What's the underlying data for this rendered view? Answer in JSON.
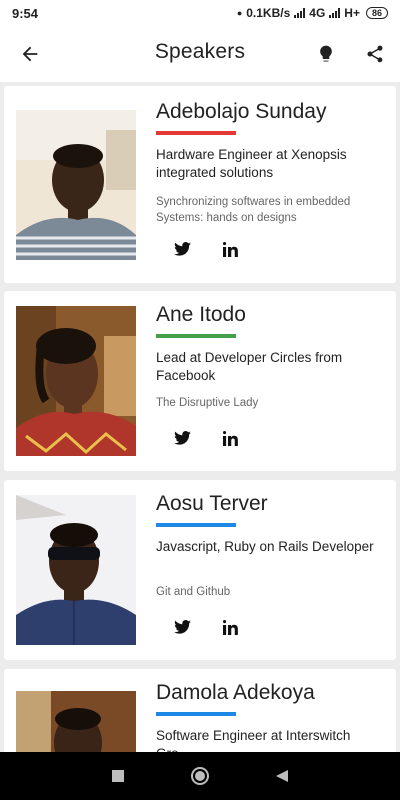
{
  "status_bar": {
    "time": "9:54",
    "net_speed": "0.1KB/s",
    "network_type": "4G",
    "network_type_2": "H+",
    "battery": "86"
  },
  "app_bar": {
    "title": "Speakers",
    "back_icon": "arrow-back-icon",
    "bulb_icon": "lightbulb-icon",
    "share_icon": "share-icon"
  },
  "speakers": [
    {
      "name": "Adebolajo Sunday",
      "accent": "#e53935",
      "role": "Hardware Engineer at Xenopsis integrated solutions",
      "talk": "Synchronizing softwares in embedded Systems: hands on designs"
    },
    {
      "name": "Ane Itodo",
      "accent": "#43a047",
      "role": "Lead at Developer Circles from Facebook",
      "talk": "The Disruptive Lady"
    },
    {
      "name": "Aosu Terver",
      "accent": "#1e88e5",
      "role": "Javascript, Ruby on Rails Developer",
      "talk": "Git and Github"
    },
    {
      "name": "Damola Adekoya",
      "accent": "#1e88e5",
      "role": "Software Engineer at Interswitch Gro..."
    }
  ],
  "nav_bar": {
    "recents_icon": "square-recents-icon",
    "home_icon": "circle-home-icon",
    "back_icon": "triangle-back-icon"
  }
}
